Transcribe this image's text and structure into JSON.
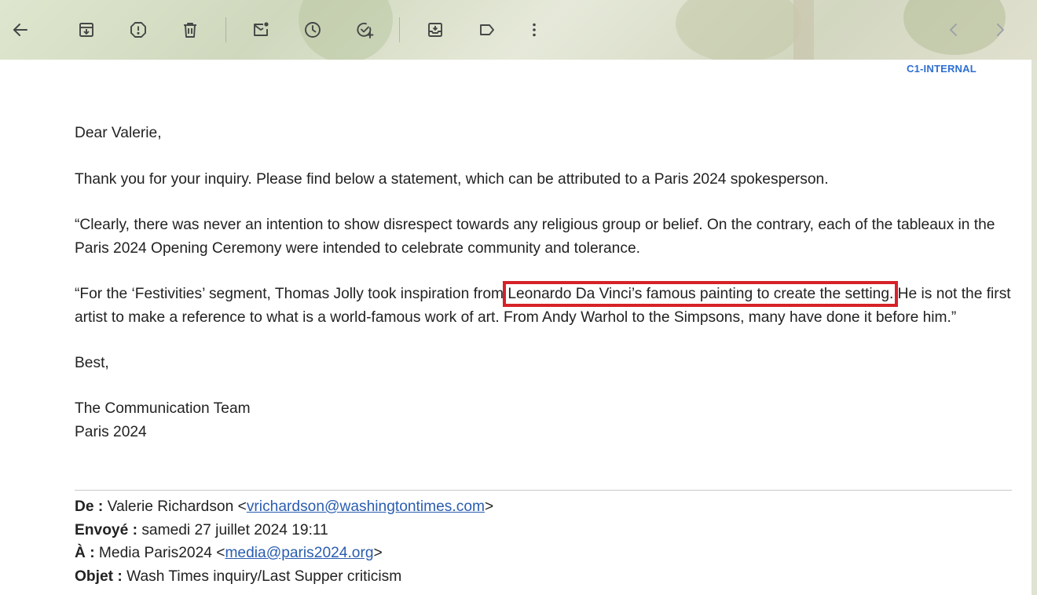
{
  "toolbar": {
    "icons": [
      {
        "name": "back-arrow-icon"
      },
      {
        "name": "archive-icon"
      },
      {
        "name": "report-spam-icon"
      },
      {
        "name": "delete-icon"
      },
      {
        "name": "mark-unread-icon"
      },
      {
        "name": "snooze-icon"
      },
      {
        "name": "add-task-icon"
      },
      {
        "name": "move-to-icon"
      },
      {
        "name": "label-icon"
      },
      {
        "name": "more-options-icon"
      },
      {
        "name": "previous-icon"
      },
      {
        "name": "next-icon"
      }
    ],
    "icon_color": "#444746"
  },
  "email": {
    "classification": "C1-INTERNAL",
    "greeting": "Dear Valerie,",
    "para1": "Thank you for your inquiry. Please find below a statement, which can be attributed to a Paris 2024 spokesperson.",
    "para2": "“Clearly, there was never an intention to show disrespect towards any religious group or belief. On the contrary, each of the tableaux in the Paris 2024 Opening Ceremony were intended to celebrate community and tolerance.",
    "para3_before": "“For the ‘Festivities’ segment, Thomas Jolly took inspiration from ",
    "para3_highlight": "Leonardo Da Vinci’s famous painting to create the setting.",
    "para3_after": " He is not the first artist to make a reference to what is a world-famous work of art. From Andy Warhol to the Simpsons, many have done it before him.”",
    "signoff": "Best,",
    "signature_line1": "The Communication Team",
    "signature_line2": "Paris 2024"
  },
  "header": {
    "from_label": "De :",
    "from_name": "Valerie Richardson <",
    "from_email": "vrichardson@washingtontimes.com",
    "from_close": ">",
    "sent_label": "Envoyé :",
    "sent_value": "samedi 27 juillet 2024 19:11",
    "to_label": "À :",
    "to_name": "Media Paris2024 <",
    "to_email": "media@paris2024.org",
    "to_close": ">",
    "subject_label": "Objet :",
    "subject_value": "Wash Times inquiry/Last Supper criticism"
  },
  "colors": {
    "highlight_box": "#d62128",
    "link": "#2a5db0",
    "classification": "#2e6fd1"
  }
}
